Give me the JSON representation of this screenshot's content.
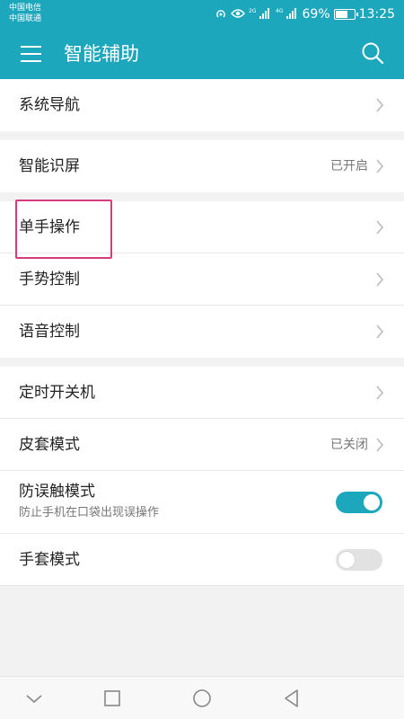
{
  "status_bar": {
    "carrier_1": "中国电信",
    "carrier_2": "中国联通",
    "network_1": "2G",
    "network_2": "4G",
    "battery_text": "69%",
    "battery_level": 0.69,
    "time": "13:25"
  },
  "app_bar": {
    "title": "智能辅助",
    "menu_icon": "menu-icon",
    "search_icon": "search-icon"
  },
  "groups": [
    {
      "items": [
        {
          "label": "系统导航"
        }
      ]
    },
    {
      "items": [
        {
          "label": "智能识屏",
          "status": "已开启"
        }
      ]
    },
    {
      "items": [
        {
          "label": "单手操作"
        },
        {
          "label": "手势控制"
        },
        {
          "label": "语音控制"
        }
      ]
    },
    {
      "items": [
        {
          "label": "定时开关机"
        },
        {
          "label": "皮套模式",
          "status": "已关闭"
        },
        {
          "label": "防误触模式",
          "subtitle": "防止手机在口袋出现误操作",
          "toggle": true
        },
        {
          "label": "手套模式",
          "toggle": false
        }
      ]
    }
  ],
  "colors": {
    "accent": "#1ca7bd",
    "highlight": "#d43c7c",
    "background": "#f2f2f2"
  },
  "nav_bar": {
    "icons": [
      "chevron-down-icon",
      "square-icon",
      "circle-icon",
      "triangle-back-icon"
    ]
  }
}
